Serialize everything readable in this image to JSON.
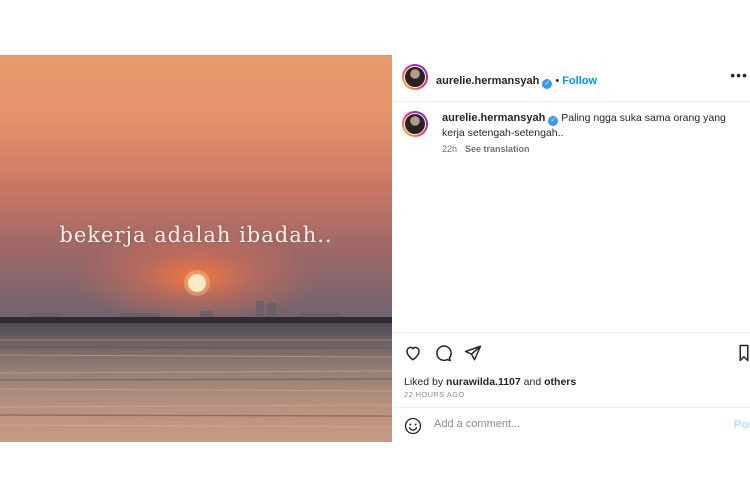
{
  "image": {
    "overlay_text": "bekerja adalah ibadah.."
  },
  "header": {
    "username": "aurelie.hermansyah",
    "verified": "✓",
    "separator": "•",
    "follow_label": "Follow",
    "more_label": "•••"
  },
  "caption": {
    "username": "aurelie.hermansyah",
    "text": "Paling ngga suka sama orang yang kerja setengah-setengah..",
    "time": "22h",
    "translation_label": "See translation"
  },
  "likes": {
    "prefix": "Liked by",
    "user": "nurawilda.1107",
    "conjunction": "and",
    "others": "others"
  },
  "timestamp": "22 HOURS AGO",
  "comment": {
    "placeholder": "Add a comment...",
    "post_label": "Post"
  },
  "icons": {
    "like": "heart-icon",
    "comment": "comment-icon",
    "share": "share-icon",
    "save": "bookmark-icon",
    "emoji": "emoji-icon",
    "more": "more-icon"
  }
}
